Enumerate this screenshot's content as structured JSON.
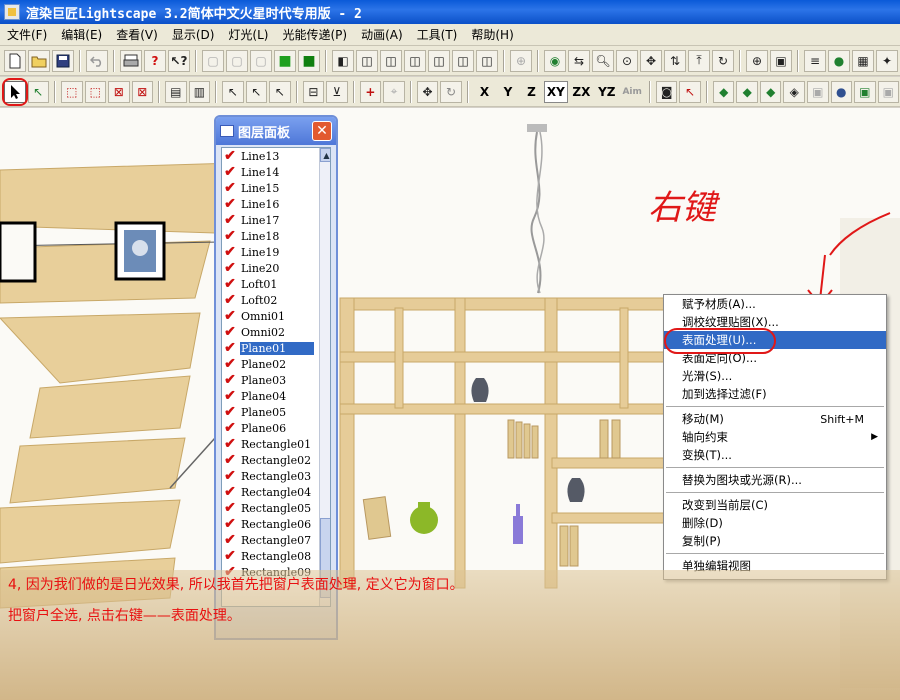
{
  "window": {
    "title": "渲染巨匠Lightscape 3.2简体中文火星时代专用版 - 2"
  },
  "menu": [
    "文件(F)",
    "编辑(E)",
    "查看(V)",
    "显示(D)",
    "灯光(L)",
    "光能传递(P)",
    "动画(A)",
    "工具(T)",
    "帮助(H)"
  ],
  "axis_toolbar": {
    "x": "X",
    "y": "Y",
    "z": "Z",
    "xy": "XY",
    "zx": "ZX",
    "yz": "YZ",
    "aim": "Aim"
  },
  "layer_panel": {
    "title": "图层面板",
    "items": [
      "Line13",
      "Line14",
      "Line15",
      "Line16",
      "Line17",
      "Line18",
      "Line19",
      "Line20",
      "Loft01",
      "Loft02",
      "Omni01",
      "Omni02",
      "Plane01",
      "Plane02",
      "Plane03",
      "Plane04",
      "Plane05",
      "Plane06",
      "Rectangle01",
      "Rectangle02",
      "Rectangle03",
      "Rectangle04",
      "Rectangle05",
      "Rectangle06",
      "Rectangle07",
      "Rectangle08",
      "Rectangle09"
    ],
    "selected": "Plane01"
  },
  "context_menu": {
    "group1": [
      "赋予材质(A)...",
      "调校纹理贴图(X)...",
      "表面处理(U)...",
      "表面定向(O)...",
      "光滑(S)...",
      "加到选择过滤(F)"
    ],
    "highlighted": "表面处理(U)...",
    "group2": [
      {
        "label": "移动(M)",
        "shortcut": "Shift+M"
      },
      {
        "label": "轴向约束",
        "submenu": true
      },
      {
        "label": "变换(T)..."
      }
    ],
    "group3": [
      "替换为图块或光源(R)..."
    ],
    "group4": [
      "改变到当前层(C)",
      "删除(D)",
      "复制(P)"
    ],
    "group5": [
      "单独编辑视图"
    ]
  },
  "annotation": "右键",
  "caption": {
    "line1": "4, 因为我们做的是日光效果, 所以我首先把窗户表面处理, 定义它为窗口。",
    "line2": "把窗户全选, 点击右键——表面处理。"
  },
  "colors": {
    "title_bar": "#0a5ad8",
    "selection": "#316ac5",
    "annotation_red": "#e01818",
    "wood": "#e6cc98"
  }
}
